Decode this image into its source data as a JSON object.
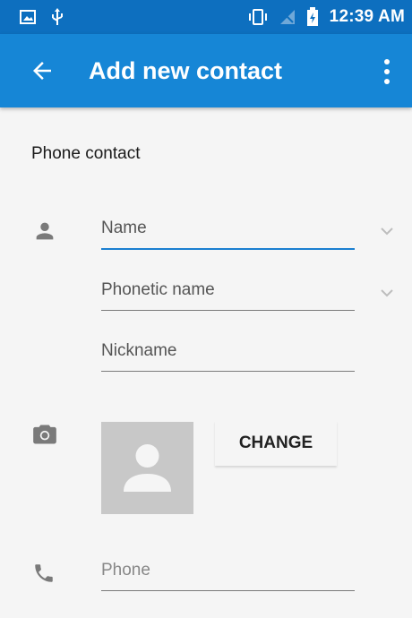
{
  "status_bar": {
    "left_icons": [
      "image-notification-icon",
      "usb-icon"
    ],
    "right_icons": [
      "vibrate-icon",
      "no-signal-icon",
      "battery-charging-icon"
    ],
    "time": "12:39 AM"
  },
  "app_bar": {
    "title": "Add new contact",
    "back_icon": "arrow-back-icon",
    "overflow_icon": "more-vert-icon"
  },
  "form": {
    "section_label": "Phone contact",
    "name_label": "Name",
    "phonetic_name_label": "Phonetic name",
    "nickname_label": "Nickname",
    "change_button_label": "CHANGE",
    "phone_label": "Phone"
  },
  "colors": {
    "status_bar": "#0d6fbf",
    "app_bar": "#1686d6",
    "focus_underline": "#1a7fd0",
    "background": "#f5f5f5"
  }
}
